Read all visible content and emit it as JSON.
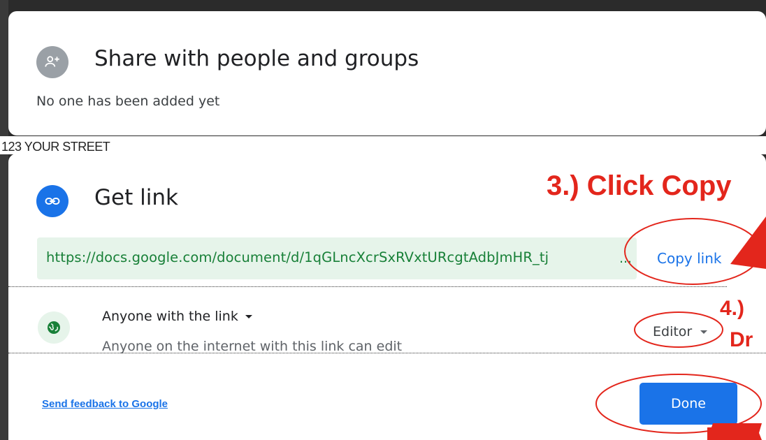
{
  "background": {
    "text": "123 YOUR STREET"
  },
  "share_card": {
    "icon": "add-person-icon",
    "title": "Share with people and groups",
    "subtitle": "No one has been added yet"
  },
  "link_card": {
    "icon": "link-icon",
    "title": "Get link",
    "url": "https://docs.google.com/document/d/1qGLncXcrSxRVxtURcgtAdbJmHR_tj",
    "url_ellipsis": "...",
    "copy_link_label": "Copy link",
    "access": {
      "icon": "globe-icon",
      "title": "Anyone with the link",
      "subtitle": "Anyone on the internet with this link can edit",
      "role": "Editor"
    },
    "feedback_label": "Send feedback to Google",
    "done_label": "Done"
  },
  "annotations": {
    "step3": "3.) Click Copy",
    "step4_line1": "4.)",
    "step4_line2": "Dr"
  },
  "colors": {
    "accent": "#1a73e8",
    "link_green": "#188038",
    "link_bg": "#e6f4ea",
    "annotation_red": "#e3261c"
  }
}
